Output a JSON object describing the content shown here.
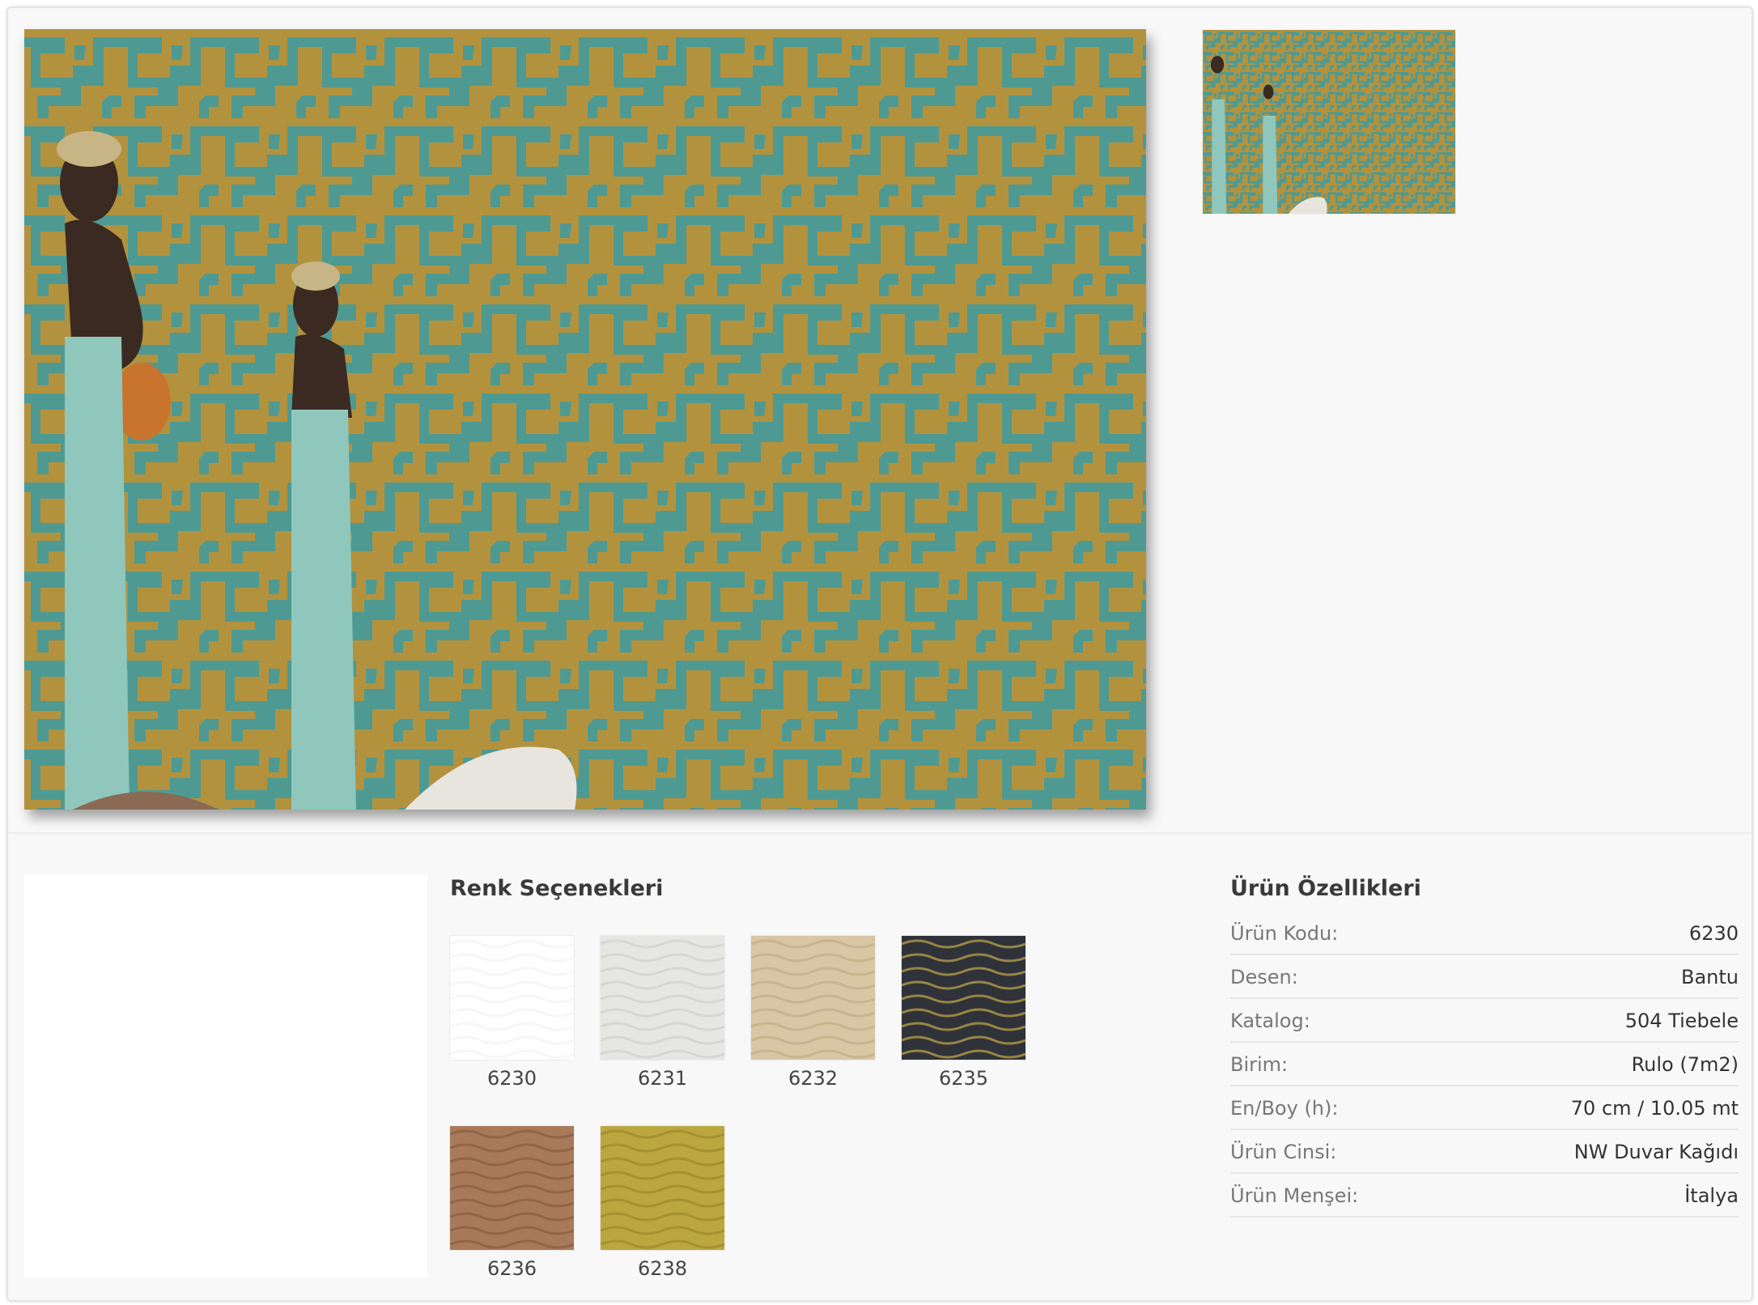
{
  "colors_section": {
    "title": "Renk Seçenekleri",
    "swatches": [
      {
        "code": "6230",
        "color": "#ffffff",
        "pattern": "#f4f4f4"
      },
      {
        "code": "6231",
        "color": "#e6e6e4",
        "pattern": "#d2d2ce"
      },
      {
        "code": "6232",
        "color": "#d8c6a4",
        "pattern": "#c4b08a"
      },
      {
        "code": "6235",
        "color": "#2f3238",
        "pattern": "#b09a48"
      },
      {
        "code": "6236",
        "color": "#a87a5a",
        "pattern": "#8c6044"
      },
      {
        "code": "6238",
        "color": "#bca640",
        "pattern": "#a08c2c"
      }
    ]
  },
  "properties": {
    "title": "Ürün Özellikleri",
    "rows": [
      {
        "label": "Ürün Kodu:",
        "value": "6230"
      },
      {
        "label": "Desen:",
        "value": "Bantu"
      },
      {
        "label": "Katalog:",
        "value": "504 Tiebele"
      },
      {
        "label": "Birim:",
        "value": "Rulo (7m2)"
      },
      {
        "label": "En/Boy (h):",
        "value": "70 cm / 10.05 mt"
      },
      {
        "label": "Ürün Cinsi:",
        "value": "NW Duvar Kağıdı"
      },
      {
        "label": "Ürün Menşei:",
        "value": "İtalya"
      }
    ]
  },
  "palette": {
    "wallpaper_gold": "#b3923e",
    "wallpaper_teal": "#4e9a92",
    "statue_body": "#3a2a22",
    "statue_robe": "#8fc7bd",
    "vase": "#c9742e"
  }
}
